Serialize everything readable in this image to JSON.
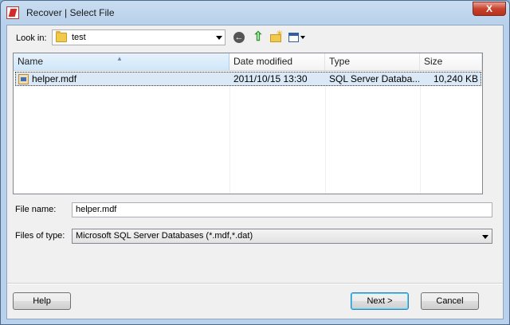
{
  "window": {
    "title": "Recover | Select File",
    "close_label": "X"
  },
  "toolbar": {
    "look_in_label": "Look in:",
    "look_in_value": "test"
  },
  "file_list": {
    "columns": [
      "Name",
      "Date modified",
      "Type",
      "Size"
    ],
    "rows": [
      {
        "name": "helper.mdf",
        "date_modified": "2011/10/15 13:30",
        "type": "SQL Server Databa...",
        "size": "10,240 KB",
        "selected": true
      }
    ]
  },
  "file_name": {
    "label": "File name:",
    "value": "helper.mdf"
  },
  "file_type": {
    "label": "Files of type:",
    "value": "Microsoft SQL Server Databases (*.mdf,*.dat)"
  },
  "buttons": {
    "help": "Help",
    "next": "Next >",
    "cancel": "Cancel"
  }
}
